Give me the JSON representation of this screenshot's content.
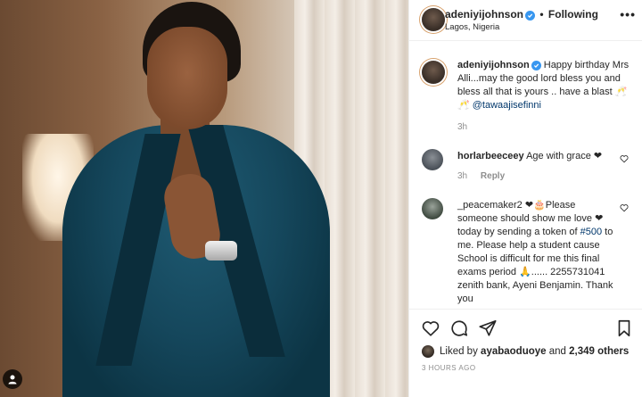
{
  "post": {
    "username": "adeniyijohnson",
    "separator": "•",
    "follow_label": "Following",
    "location": "Lagos, Nigeria",
    "more_icon": "more-dots-icon"
  },
  "caption": {
    "username": "adeniyijohnson",
    "text": "Happy birthday Mrs Alli...may the good lord bless you and bless all that is yours .. have a blast 🥂",
    "emoji_prefix": "🥂",
    "mention": "@tawaajisefinni",
    "time": "3h"
  },
  "comments": [
    {
      "username": "horlarbeeceey",
      "text": "Age with grace ❤",
      "time": "3h",
      "reply_label": "Reply"
    },
    {
      "username": "_peacemaker2",
      "text": "❤🎂Please someone should show me love ❤ today by sending a token of",
      "hashtag": "#500",
      "text_after": "to me. Please help a student cause School is difficult for me this final exams period 🙏...... 2255731041 zenith bank, Ayeni Benjamin. Thank you"
    }
  ],
  "actions": {
    "like_icon": "heart-icon",
    "comment_icon": "comment-icon",
    "share_icon": "share-icon",
    "save_icon": "bookmark-icon"
  },
  "likes": {
    "prefix": "Liked by",
    "user": "ayabaoduoye",
    "conj": "and",
    "others": "2,349 others"
  },
  "timestamp": "3 HOURS AGO",
  "colors": {
    "verified": "#3897f0",
    "link": "#00376b",
    "muted": "#8e8e8e"
  }
}
